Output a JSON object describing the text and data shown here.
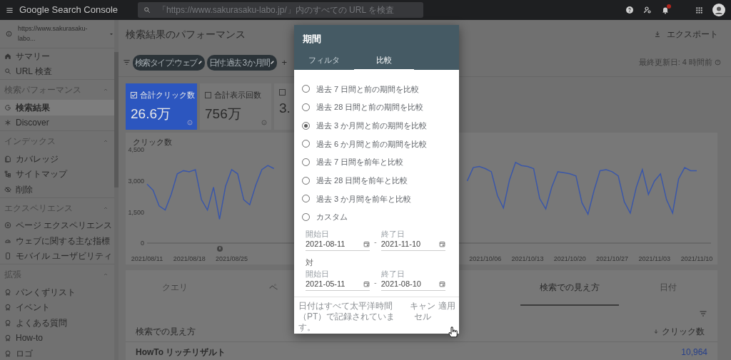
{
  "top_bar": {
    "product_name": "Google Search Console",
    "search": {
      "placeholder": "「https://www.sakurasaku-labo.jp/」内のすべての URL を検査"
    }
  },
  "sidebar": {
    "property": "https://www.sakurasaku-labo...",
    "sections": [
      {
        "items": [
          {
            "label": "サマリー",
            "selected": false
          },
          {
            "label": "URL 検査",
            "selected": false
          }
        ]
      },
      {
        "heading": "検索パフォーマンス",
        "expanded": true,
        "items": [
          {
            "label": "検索結果",
            "selected": true
          },
          {
            "label": "Discover",
            "selected": false
          }
        ]
      },
      {
        "heading": "インデックス",
        "expanded": true,
        "items": [
          {
            "label": "カバレッジ",
            "selected": false
          },
          {
            "label": "サイトマップ",
            "selected": false
          },
          {
            "label": "削除",
            "selected": false
          }
        ]
      },
      {
        "heading": "エクスペリエンス",
        "expanded": true,
        "items": [
          {
            "label": "ページ エクスペリエンス",
            "selected": false
          },
          {
            "label": "ウェブに関する主な指標",
            "selected": false
          },
          {
            "label": "モバイル ユーザビリティ",
            "selected": false
          }
        ]
      },
      {
        "heading": "拡張",
        "expanded": true,
        "items": [
          {
            "label": "パンくずリスト",
            "selected": false
          },
          {
            "label": "イベント",
            "selected": false
          },
          {
            "label": "よくある質問",
            "selected": false
          },
          {
            "label": "How-to",
            "selected": false
          },
          {
            "label": "ロゴ",
            "selected": false
          }
        ]
      }
    ]
  },
  "page_header": {
    "title": "検索結果のパフォーマンス",
    "export_label": "エクスポート"
  },
  "filters": {
    "chips": [
      "検索タイプ: ウェブ",
      "日付: 過去 3 か月間"
    ],
    "add_label": "+",
    "last_updated": "最終更新日: 4 時間前"
  },
  "metrics": [
    {
      "label": "合計クリック数",
      "value": "26.6万",
      "checked": true
    },
    {
      "label": "合計表示回数",
      "value": "756万",
      "checked": false
    },
    {
      "value": "3.",
      "checked": false
    }
  ],
  "chart": {
    "chart_data": {
      "type": "line",
      "ylabel": "クリック数",
      "ylim": [
        0,
        4500
      ],
      "categories": [
        "2021/08/11",
        null,
        null,
        null,
        null,
        null,
        null,
        "2021/08/18",
        null,
        null,
        null,
        null,
        null,
        null,
        "2021/08/25",
        null,
        null,
        null,
        null,
        null,
        null,
        null,
        null,
        null,
        null,
        null,
        null,
        null,
        null,
        null,
        null,
        null,
        null,
        null,
        null,
        null,
        null,
        null,
        null,
        null,
        null,
        null,
        null,
        null,
        null,
        null,
        null,
        null,
        null,
        null,
        null,
        null,
        null,
        null,
        null,
        null,
        "2021/10/06",
        null,
        null,
        null,
        null,
        null,
        null,
        "2021/10/13",
        null,
        null,
        null,
        null,
        null,
        null,
        "2021/10/20",
        null,
        null,
        null,
        null,
        null,
        null,
        "2021/10/27",
        null,
        null,
        null,
        null,
        null,
        null,
        "2021/11/03",
        null,
        null,
        null,
        null,
        null,
        null,
        "2021/11/10"
      ],
      "yticks": [
        {
          "value": 0,
          "label": "0"
        },
        {
          "value": 1500,
          "label": "1,500"
        },
        {
          "value": 3000,
          "label": "3,000"
        },
        {
          "value": 4500,
          "label": "4,500"
        }
      ],
      "series": [
        {
          "color": "#3b57a8",
          "values": [
            2850,
            2550,
            1800,
            1600,
            2350,
            3350,
            3500,
            3450,
            3550,
            2100,
            1600,
            2700,
            1150,
            2750,
            3550,
            3350,
            2100,
            1850,
            2800,
            3550,
            3750,
            3600,
            null,
            null,
            null,
            null,
            null,
            null,
            null,
            null,
            null,
            null,
            null,
            null,
            null,
            null,
            null,
            null,
            null,
            null,
            null,
            null,
            null,
            null,
            null,
            null,
            null,
            null,
            null,
            null,
            null,
            null,
            null,
            3000,
            3650,
            3700,
            3600,
            3450,
            2300,
            1700,
            3050,
            3900,
            3750,
            3700,
            3600,
            2150,
            1650,
            2700,
            3450,
            3400,
            3350,
            3250,
            1950,
            1400,
            2550,
            3500,
            3550,
            3450,
            3250,
            2000,
            1450,
            2700,
            3550,
            2350,
            3000,
            3350,
            2100,
            1450,
            3100,
            3650,
            3500,
            3500
          ]
        }
      ]
    }
  },
  "table": {
    "tabs": [
      {
        "label": "クエリ",
        "selected": false
      },
      {
        "label": "ペ",
        "selected": false
      },
      {
        "label": "検索での見え方",
        "selected": true
      },
      {
        "label": "日付",
        "selected": false
      }
    ],
    "columns": [
      "検索での見え方",
      "クリック数"
    ],
    "rows": [
      [
        "HowTo リッチリザルト",
        "10,964"
      ]
    ]
  },
  "dialog": {
    "title": "期間",
    "tabs": [
      {
        "label": "フィルタ",
        "selected": false
      },
      {
        "label": "比較",
        "selected": true
      }
    ],
    "options": [
      {
        "label": "過去 7 日間と前の期間を比較",
        "selected": false
      },
      {
        "label": "過去 28 日間と前の期間を比較",
        "selected": false
      },
      {
        "label": "過去 3 か月間と前の期間を比較",
        "selected": true
      },
      {
        "label": "過去 6 か月間と前の期間を比較",
        "selected": false
      },
      {
        "label": "過去 7 日間を前年と比較",
        "selected": false
      },
      {
        "label": "過去 28 日間を前年と比較",
        "selected": false
      },
      {
        "label": "過去 3 か月間を前年と比較",
        "selected": false
      },
      {
        "label": "カスタム",
        "selected": false
      }
    ],
    "range": {
      "start_label": "開始日",
      "start": "2021-08-11",
      "separator": "-",
      "end_label": "終了日",
      "end": "2021-11-10"
    },
    "vs_label": "対",
    "compare_range": {
      "start_label": "開始日",
      "start": "2021-05-11",
      "separator": "-",
      "end_label": "終了日",
      "end": "2021-08-10"
    },
    "footnote": "日付はすべて太平洋時間（PT）で記録されています。",
    "cancel_label": "キャンセル",
    "apply_label": "適用"
  }
}
